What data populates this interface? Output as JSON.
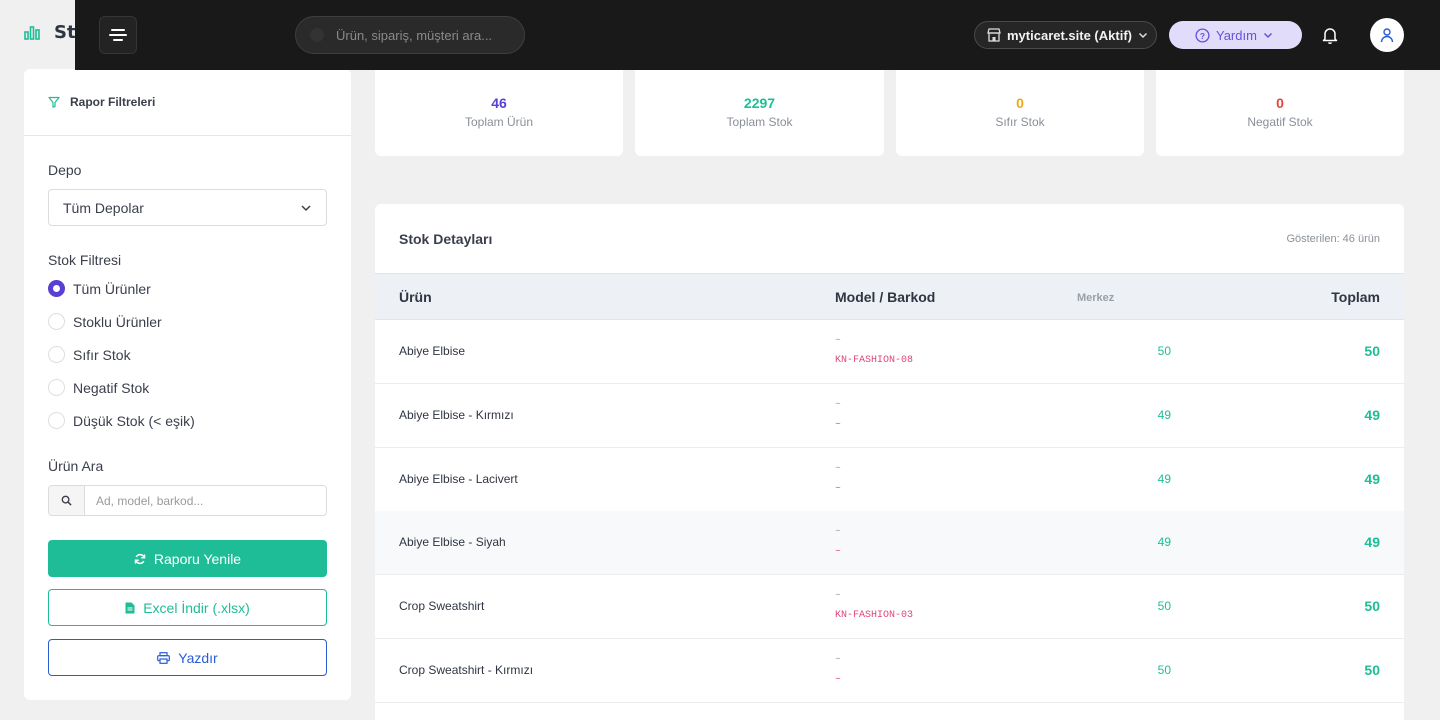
{
  "page": {
    "title_partial": "Sto"
  },
  "topbar": {
    "search_placeholder": "Ürün, sipariş, müşteri ara...",
    "site_label": "myticaret.site (Aktif)",
    "help_label": "Yardım",
    "icons": [
      "menu-icon",
      "store-icon",
      "chevron-down-icon",
      "help-icon",
      "bell-icon",
      "user-icon"
    ]
  },
  "filters": {
    "title": "Rapor Filtreleri",
    "warehouse_label": "Depo",
    "warehouse_selected": "Tüm Depolar",
    "stock_filter_label": "Stok Filtresi",
    "stock_options": [
      {
        "label": "Tüm Ürünler",
        "checked": true
      },
      {
        "label": "Stoklu Ürünler",
        "checked": false
      },
      {
        "label": "Sıfır Stok",
        "checked": false
      },
      {
        "label": "Negatif Stok",
        "checked": false
      },
      {
        "label": "Düşük Stok (< eşik)",
        "checked": false
      }
    ],
    "product_search_label": "Ürün Ara",
    "product_search_placeholder": "Ad, model, barkod...",
    "refresh_button": "Raporu Yenile",
    "excel_button": "Excel İndir (.xlsx)",
    "print_button": "Yazdır"
  },
  "stats": [
    {
      "value": "46",
      "label": "Toplam Ürün",
      "color": "#5a3fd4"
    },
    {
      "value": "2297",
      "label": "Toplam Stok",
      "color": "#1fbd97"
    },
    {
      "value": "0",
      "label": "Sıfır Stok",
      "color": "#f0a818"
    },
    {
      "value": "0",
      "label": "Negatif Stok",
      "color": "#e2453c"
    }
  ],
  "table": {
    "title": "Stok Detayları",
    "shown_text": "Gösterilen: 46 ürün",
    "columns": {
      "product": "Ürün",
      "model_barcode": "Model / Barkod",
      "warehouse": "Merkez",
      "total": "Toplam"
    },
    "rows": [
      {
        "name": "Abiye Elbise",
        "model": "–",
        "barcode": "KN-FASHION-08",
        "merkez": "50",
        "total": "50"
      },
      {
        "name": "Abiye Elbise - Kırmızı",
        "model": "–",
        "barcode": "–",
        "merkez": "49",
        "total": "49"
      },
      {
        "name": "Abiye Elbise - Lacivert",
        "model": "–",
        "barcode": "–",
        "merkez": "49",
        "total": "49"
      },
      {
        "name": "Abiye Elbise - Siyah",
        "model": "–",
        "barcode": "–",
        "merkez": "49",
        "total": "49"
      },
      {
        "name": "Crop Sweatshirt",
        "model": "–",
        "barcode": "KN-FASHION-03",
        "merkez": "50",
        "total": "50"
      },
      {
        "name": "Crop Sweatshirt - Kırmızı",
        "model": "–",
        "barcode": "–",
        "merkez": "50",
        "total": "50"
      }
    ]
  },
  "colors": {
    "accent": "#5a3fd4",
    "success": "#1fbd97",
    "primary_blue": "#2a5bd7",
    "barcode": "#e0457b"
  }
}
